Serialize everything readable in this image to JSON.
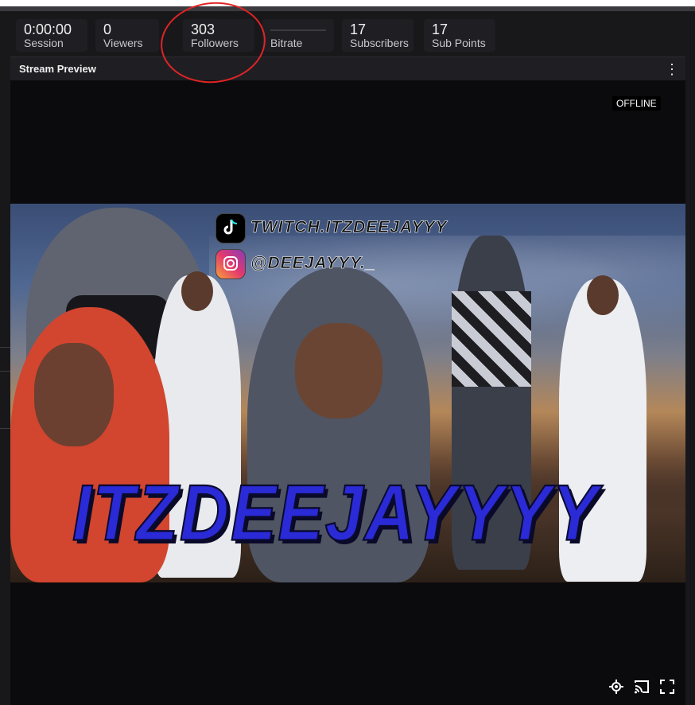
{
  "stats": [
    {
      "value": "0:00:00",
      "label": "Session"
    },
    {
      "value": "0",
      "label": "Viewers"
    },
    {
      "value": "303",
      "label": "Followers"
    },
    {
      "value": "",
      "label": "Bitrate"
    },
    {
      "value": "17",
      "label": "Subscribers"
    },
    {
      "value": "17",
      "label": "Sub Points"
    }
  ],
  "panel": {
    "title": "Stream Preview",
    "more_icon": "more-vertical-icon"
  },
  "player": {
    "status_badge": "OFFLINE",
    "controls": [
      {
        "icon": "settings-icon"
      },
      {
        "icon": "cast-icon"
      },
      {
        "icon": "fullscreen-icon"
      }
    ]
  },
  "banner": {
    "tiktok_handle": "TWITCH.ITZDEEJAYYY",
    "instagram_handle": "@DEEJAYYY._",
    "channel_name": "ITZDEEJAYYYY"
  },
  "colors": {
    "background": "#0e0e10",
    "card": "#1f1f23",
    "annotation_ring": "#e02424",
    "name_blue": "#2a2ad6"
  }
}
